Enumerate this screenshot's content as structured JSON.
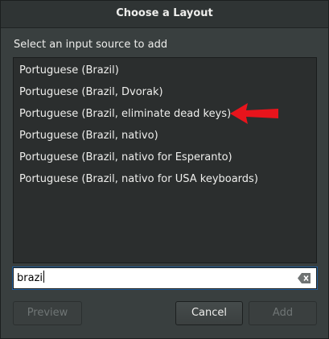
{
  "dialog": {
    "title": "Choose a Layout",
    "prompt": "Select an input source to add"
  },
  "layouts": [
    {
      "label": "Portuguese (Brazil)"
    },
    {
      "label": "Portuguese (Brazil, Dvorak)"
    },
    {
      "label": "Portuguese (Brazil, eliminate dead keys)"
    },
    {
      "label": "Portuguese (Brazil, nativo)"
    },
    {
      "label": "Portuguese (Brazil, nativo for Esperanto)"
    },
    {
      "label": "Portuguese (Brazil, nativo for USA keyboards)"
    }
  ],
  "search": {
    "value": "brazi"
  },
  "buttons": {
    "preview": "Preview",
    "cancel": "Cancel",
    "add": "Add"
  },
  "annotation": {
    "arrow_color": "#e8141c",
    "points_to": "Portuguese (Brazil, eliminate dead keys)"
  },
  "icons": {
    "clear": "clear-text-icon",
    "arrow": "red-arrow-icon"
  },
  "colors": {
    "dialog_bg": "#393f3f",
    "list_bg": "#2b2e2e",
    "focus_ring": "#215d9c"
  }
}
